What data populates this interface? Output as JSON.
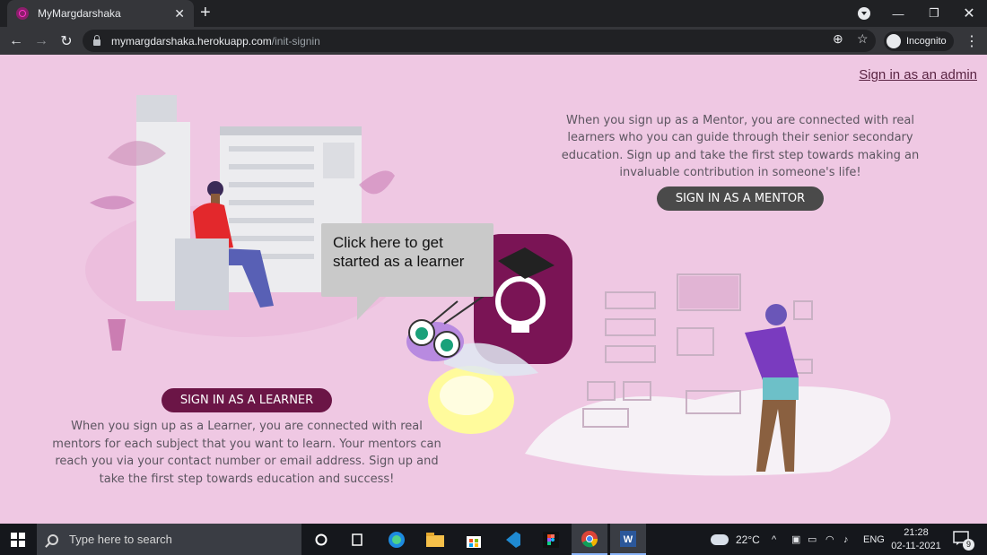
{
  "browser": {
    "tab_title": "MyMargdarshaka",
    "url_host": "mymargdarshaka.herokuapp.com",
    "url_path": "/init-signin",
    "incognito_label": "Incognito"
  },
  "page": {
    "admin_link": "Sign in as an admin",
    "mentor_text": "When you sign up as a Mentor, you are connected with real learners who you can guide through their senior secondary education. Sign up and take the first step towards making an invaluable contribution in someone's life!",
    "mentor_button": "SIGN IN AS A MENTOR",
    "learner_button": "SIGN IN AS A LEARNER",
    "learner_text": "When you sign up as a Learner, you are connected with real mentors for each subject that you want to learn. Your mentors can reach you via your contact number or email address. Sign up and take the first step towards education and success!",
    "bubble_text": "Click here to get started as a learner",
    "colors": {
      "background": "#efc8e3",
      "learner_button": "#6b1546",
      "mentor_button": "#4a4a4a"
    }
  },
  "taskbar": {
    "search_placeholder": "Type here to search",
    "temperature": "22°C",
    "language": "ENG",
    "time": "21:28",
    "date": "02-11-2021",
    "notification_count": "9",
    "apps": [
      "cortana-icon",
      "task-view-icon",
      "edge-icon",
      "file-explorer-icon",
      "store-icon",
      "vscode-icon",
      "figma-icon",
      "chrome-icon",
      "word-icon"
    ]
  }
}
